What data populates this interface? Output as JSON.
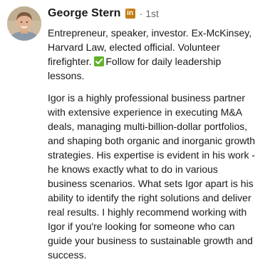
{
  "author": {
    "name": "George Stern",
    "degree": "1st",
    "separator": "·",
    "linkedin_badge_label": "in",
    "badge_color": "#c37d16",
    "headline_before_emoji": "Entrepreneur, speaker, investor. Ex-McKinsey, Harvard Law, elected official. Volunteer firefighter.",
    "emoji_icon": "check-mark-button-icon",
    "emoji_color": "#5fb32a",
    "headline_after_emoji": "Follow for daily leadership lessons."
  },
  "recommendation_text": "Igor is a highly professional business partner with extensive experience in executing M&A deals, managing multi-billion-dollar portfolios, and shaping both organic and inorganic growth strategies. His expertise is evident in his work - he knows exactly what to do in various business scenarios. What sets Igor apart is his ability to identify the right solutions and deliver real results. I highly recommend working with Igor if you're looking for someone who can guide your business to sustainable growth and success."
}
